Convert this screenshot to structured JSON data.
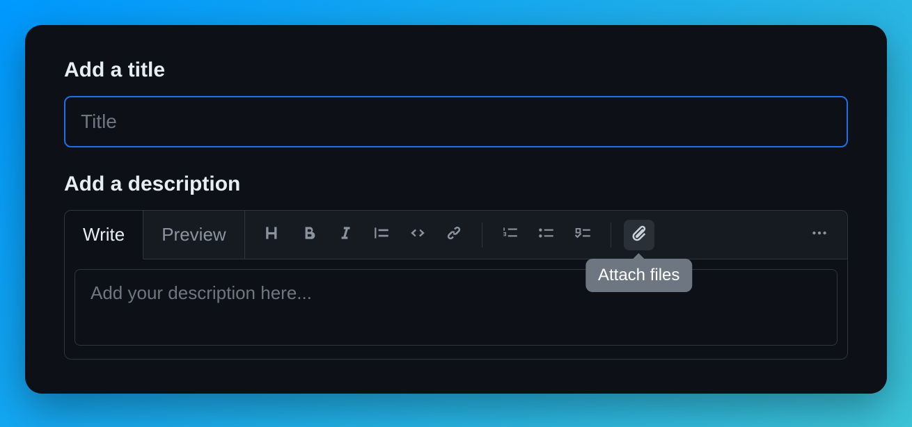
{
  "title_section": {
    "label": "Add a title",
    "placeholder": "Title",
    "value": ""
  },
  "description_section": {
    "label": "Add a description",
    "placeholder": "Add your description here...",
    "value": ""
  },
  "tabs": {
    "write": "Write",
    "preview": "Preview"
  },
  "tooltip": {
    "attach": "Attach files"
  }
}
